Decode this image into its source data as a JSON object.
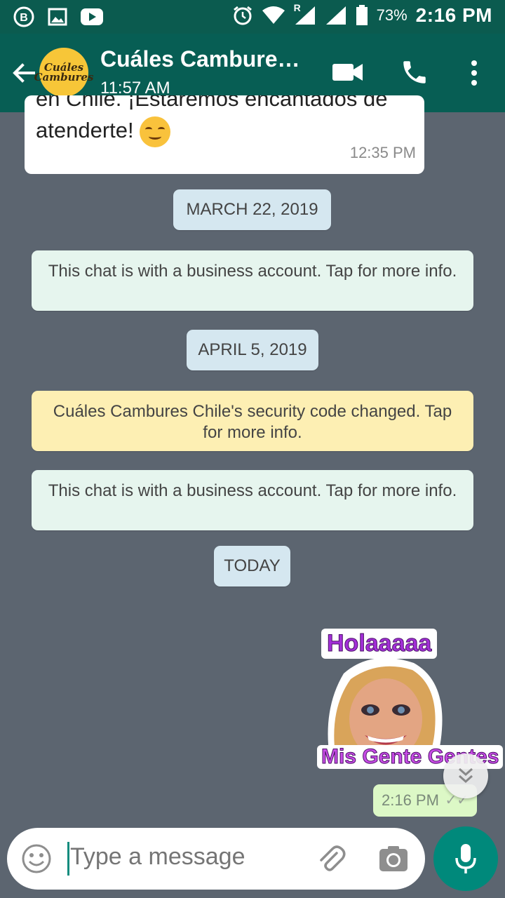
{
  "status_bar": {
    "battery": "73%",
    "time": "2:16 PM",
    "roaming": "R",
    "icons": [
      "whatsapp-business-icon",
      "gallery-icon",
      "youtube-icon",
      "alarm-icon",
      "wifi-icon",
      "signal-icon",
      "battery-icon"
    ]
  },
  "header": {
    "avatar_text": "Cuáles Cambures",
    "title": "Cuáles Cambure…",
    "subtitle": "11:57 AM",
    "icons": [
      "back-arrow-icon",
      "video-call-icon",
      "phone-icon",
      "more-vert-icon"
    ]
  },
  "messages": {
    "incoming": {
      "line1": "en Chile. ¡Estaremos encantados de",
      "line2": "atenderte!",
      "emoji": "smiling-face-icon",
      "time": "12:35 PM"
    },
    "date1": "MARCH 22, 2019",
    "business_note_1": "This chat is with a business account. Tap for more info.",
    "date2": "APRIL 5, 2019",
    "security_note": "Cuáles Cambures Chile's security code changed. Tap for more info.",
    "business_note_2": "This chat is with a business account. Tap for more info.",
    "date3": "TODAY",
    "sticker": {
      "top_text": "Holaaaaa",
      "bottom_text": "Mis Gente Gentes"
    },
    "outgoing_time": "2:16 PM"
  },
  "composer": {
    "placeholder": "Type a message",
    "icons": [
      "emoji-icon",
      "attach-icon",
      "camera-icon",
      "mic-icon",
      "scroll-down-icon"
    ]
  },
  "colors": {
    "header": "#075e54",
    "chat_bg": "#5c6570",
    "outgoing": "#dcf8c6",
    "mic": "#00897b"
  }
}
